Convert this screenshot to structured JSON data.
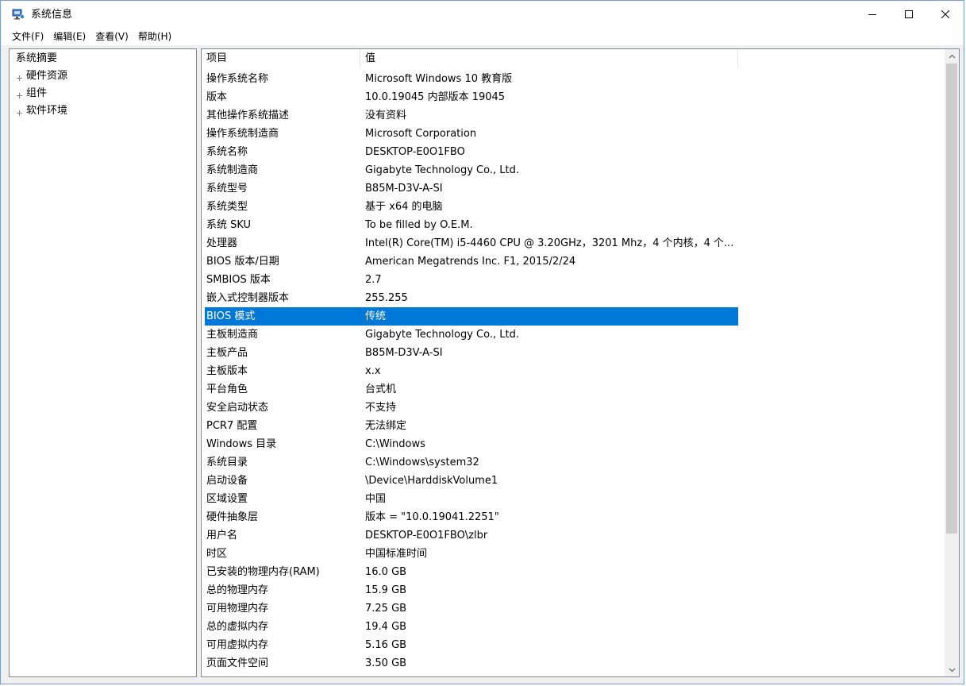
{
  "window": {
    "title": "系统信息",
    "icon": "system-info-icon"
  },
  "menu": [
    {
      "label": "文件(F)"
    },
    {
      "label": "编辑(E)"
    },
    {
      "label": "查看(V)"
    },
    {
      "label": "帮助(H)"
    }
  ],
  "tree": {
    "root": "系统摘要",
    "children": [
      {
        "label": "硬件资源"
      },
      {
        "label": "组件"
      },
      {
        "label": "软件环境"
      }
    ]
  },
  "table": {
    "headers": {
      "item": "项目",
      "value": "值"
    },
    "selected_index": 13,
    "rows": [
      {
        "item": "操作系统名称",
        "value": "Microsoft Windows 10 教育版"
      },
      {
        "item": "版本",
        "value": "10.0.19045 内部版本 19045"
      },
      {
        "item": "其他操作系统描述",
        "value": "没有资料"
      },
      {
        "item": "操作系统制造商",
        "value": "Microsoft Corporation"
      },
      {
        "item": "系统名称",
        "value": "DESKTOP-E0O1FBO"
      },
      {
        "item": "系统制造商",
        "value": "Gigabyte Technology Co., Ltd."
      },
      {
        "item": "系统型号",
        "value": "B85M-D3V-A-SI"
      },
      {
        "item": "系统类型",
        "value": "基于 x64 的电脑"
      },
      {
        "item": "系统 SKU",
        "value": "To be filled by O.E.M."
      },
      {
        "item": "处理器",
        "value": "Intel(R) Core(TM) i5-4460  CPU @ 3.20GHz，3201 Mhz，4 个内核，4 个..."
      },
      {
        "item": "BIOS 版本/日期",
        "value": "American Megatrends Inc. F1, 2015/2/24"
      },
      {
        "item": "SMBIOS 版本",
        "value": "2.7"
      },
      {
        "item": "嵌入式控制器版本",
        "value": "255.255"
      },
      {
        "item": "BIOS 模式",
        "value": "传统"
      },
      {
        "item": "主板制造商",
        "value": "Gigabyte Technology Co., Ltd."
      },
      {
        "item": "主板产品",
        "value": "B85M-D3V-A-SI"
      },
      {
        "item": "主板版本",
        "value": "x.x"
      },
      {
        "item": "平台角色",
        "value": "台式机"
      },
      {
        "item": "安全启动状态",
        "value": "不支持"
      },
      {
        "item": "PCR7 配置",
        "value": "无法绑定"
      },
      {
        "item": "Windows 目录",
        "value": "C:\\Windows"
      },
      {
        "item": "系统目录",
        "value": "C:\\Windows\\system32"
      },
      {
        "item": "启动设备",
        "value": "\\Device\\HarddiskVolume1"
      },
      {
        "item": "区域设置",
        "value": "中国"
      },
      {
        "item": "硬件抽象层",
        "value": "版本 = \"10.0.19041.2251\""
      },
      {
        "item": "用户名",
        "value": "DESKTOP-E0O1FBO\\zlbr"
      },
      {
        "item": "时区",
        "value": "中国标准时间"
      },
      {
        "item": "已安装的物理内存(RAM)",
        "value": "16.0 GB"
      },
      {
        "item": "总的物理内存",
        "value": "15.9 GB"
      },
      {
        "item": "可用物理内存",
        "value": "7.25 GB"
      },
      {
        "item": "总的虚拟内存",
        "value": "19.4 GB"
      },
      {
        "item": "可用虚拟内存",
        "value": "5.16 GB"
      },
      {
        "item": "页面文件空间",
        "value": "3.50 GB"
      }
    ]
  },
  "colors": {
    "selection": "#0078d7",
    "selection_text": "#ffffff",
    "scrollbar_thumb": "#cdcdcd"
  }
}
